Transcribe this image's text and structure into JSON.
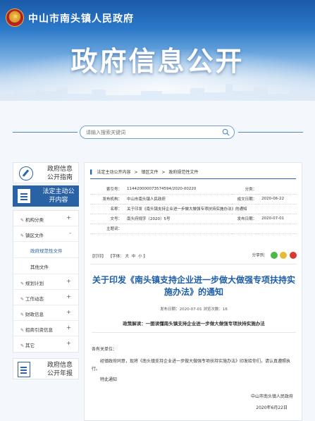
{
  "header": {
    "site_name": "中山市南头镇人民政府",
    "banner_title": "政府信息公开"
  },
  "search": {
    "placeholder": "请输入搜索关键词"
  },
  "sidebar": {
    "guide": "政府信息公开指南",
    "active": "法定主动公开内容",
    "menu": [
      {
        "label": "机构分类",
        "sign": "+"
      },
      {
        "label": "镇区文件",
        "sign": "-"
      },
      {
        "label": "规划计划",
        "sign": "+"
      },
      {
        "label": "工作动态",
        "sign": "+"
      },
      {
        "label": "财政信息",
        "sign": "+"
      },
      {
        "label": "招商引资信息",
        "sign": "+"
      },
      {
        "label": "其它",
        "sign": "+"
      }
    ],
    "submenu": [
      "政府规范性文件",
      "其他文件"
    ],
    "report": "政府信息公开年报"
  },
  "breadcrumb": {
    "items": [
      "法定主动公开内容",
      "镇区文件",
      "政府规范性文件"
    ],
    "sep": ">"
  },
  "meta": {
    "index_label": "索引号：",
    "index_value": "11442000007357459​4/2020-00220",
    "category_label": "分类：",
    "category_value": "",
    "org_label": "发布机构：",
    "org_value": "中山市南头镇人民政府",
    "gen_date_label": "成文日期：",
    "gen_date_value": "2020-06-22",
    "name_label": "名称：",
    "name_value": "关于印发《南头镇支持企业进一步做大做强专项扶持实施办法》的通知",
    "doc_no_label": "文号：",
    "doc_no_value": "南头府规字〔2020〕5号",
    "pub_date_label": "发布日期：",
    "pub_date_value": "2020-07-01",
    "subject_label": "主题词：",
    "subject_value": ""
  },
  "tools": {
    "print": "【打印】",
    "font_prefix": "【字体：",
    "font_big": "大",
    "font_mid": "中",
    "font_small": "小",
    "font_suffix": "】",
    "share": "分享到："
  },
  "document": {
    "title": "关于印发《南头镇支持企业进一步做大做强专项扶持实施办法》的通知",
    "date_line": "发布日期：2020-07-01  浏览次数：16",
    "interpretation": "政策解读：一图读懂南头镇支持企业进一步做大做强专项扶持实施办法",
    "salutation": "各有关单位：",
    "paragraph": "经镇政府同意，现将《南头镇支持企业进一步做大做强专项扶持实施办法》印发给你们，请认真遵照执行。",
    "closing": "特此通知",
    "signature": "中山市南头镇人民政府",
    "sign_date": "2020年6月22日"
  },
  "colors": {
    "accent": "#2a63a5",
    "title_blue": "#1e5ea7"
  }
}
